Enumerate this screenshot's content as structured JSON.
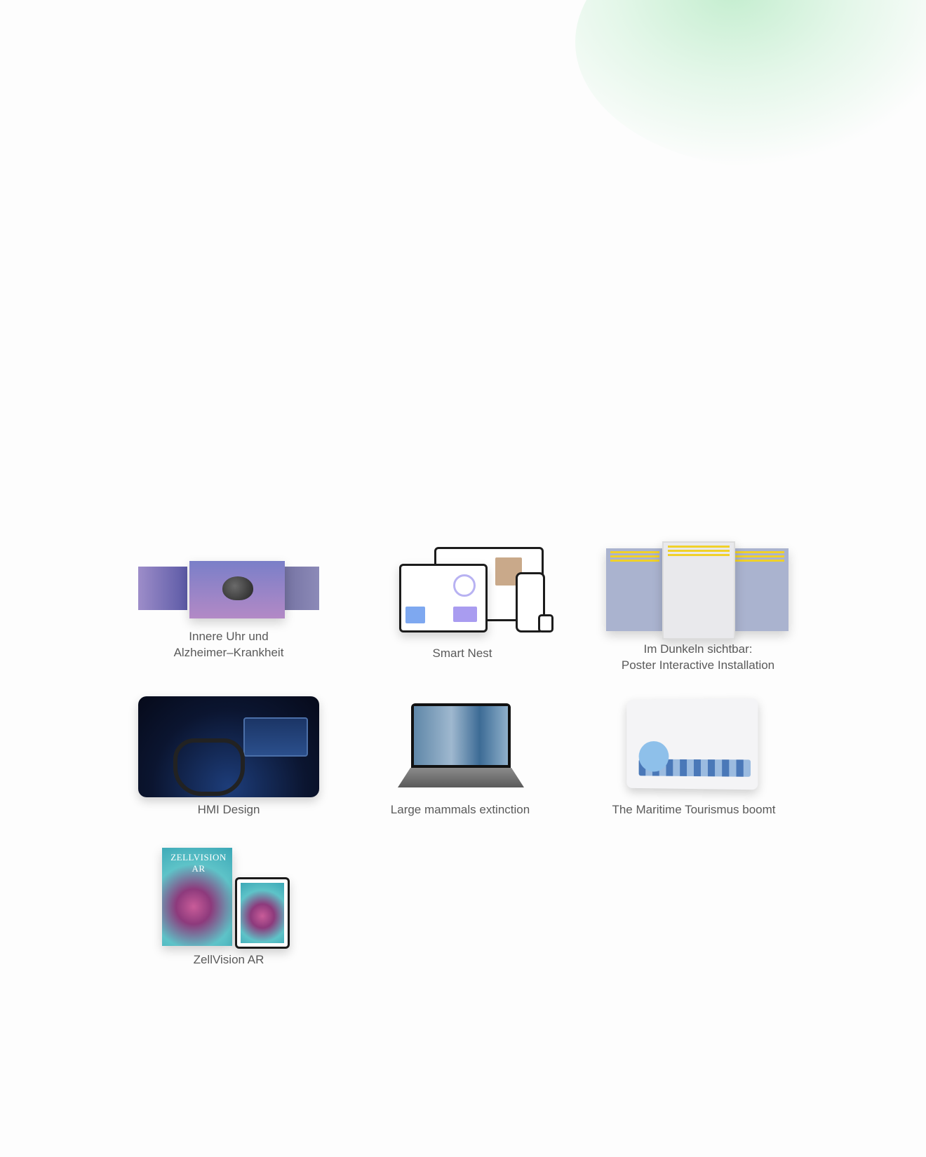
{
  "projects": [
    {
      "caption_lines": [
        "Innere Uhr und",
        "Alzheimer–Krankheit"
      ]
    },
    {
      "caption_lines": [
        "Smart Nest"
      ]
    },
    {
      "caption_lines": [
        "Im Dunkeln sichtbar:",
        "Poster Interactive Installation"
      ]
    },
    {
      "caption_lines": [
        "HMI Design"
      ]
    },
    {
      "caption_lines": [
        "Large mammals extinction"
      ]
    },
    {
      "caption_lines": [
        "The Maritime Tourismus boomt"
      ]
    },
    {
      "caption_lines": [
        "ZellVision AR"
      ]
    }
  ],
  "colors": {
    "glow": "#a8e6bb",
    "caption": "#5a5a5a",
    "background": "#fdfdfd"
  },
  "zellvision_cover_title": "ZELLVISION AR"
}
